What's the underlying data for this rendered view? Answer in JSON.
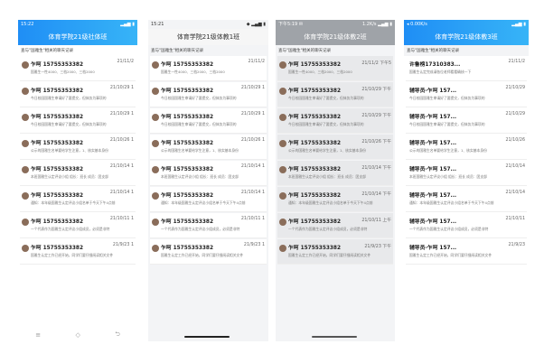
{
  "phones": [
    {
      "status": {
        "time": "15:22",
        "right": "▂▄▆ ▮"
      },
      "header": "体育学院21级社体班",
      "sub": "查与\"国雅生\"相关的聊天记录",
      "items": [
        {
          "name": "乍呵 15755353382",
          "date": "21/11/2",
          "msg": "国雅生一性4000、三档2000、三档2000"
        },
        {
          "name": "乍呵 15755353382",
          "date": "21/10/29 1",
          "msg": "今日校园国雅生审请好了要提交，但体务为事项的"
        },
        {
          "name": "乍呵 15755353382",
          "date": "21/10/29 1",
          "msg": "今日校园国雅生审请好了要提交，但体务为事项的"
        },
        {
          "name": "乍呵 15755353382",
          "date": "21/10/26 1",
          "msg": "公示的国雅生名单要给学生注意，1、核实基本身份"
        },
        {
          "name": "乍呵 15755353382",
          "date": "21/10/14 1",
          "msg": "本班国雅生认定评议小组 组长：班长 成员：团支部"
        },
        {
          "name": "乍呵 15755353382",
          "date": "21/10/14 1",
          "msg": "通知：本年级国雅生认定评议小组名单于今天下午4点前"
        },
        {
          "name": "乍呵 15755353382",
          "date": "21/10/11 1",
          "msg": "一个代表作为国雅生认定评议小组成员，必须是非特"
        },
        {
          "name": "乍呵 15755353382",
          "date": "21/9/23 1",
          "msg": "国雅生认定工作已经开始，同学们要仔细阅读相关文件"
        }
      ],
      "nav": [
        "≡",
        "◇",
        "⮌"
      ]
    },
    {
      "status": {
        "time": "15:21",
        "right": "◆ ▂▄▆ ▮"
      },
      "header": "体育学院21级体教1班",
      "sub": "查与\"国雅生\"相关的聊天记录",
      "items": [
        {
          "name": "乍呵 15755353382",
          "date": "21/11/2",
          "msg": "国雅生一性4000、三档2000、三档2000"
        },
        {
          "name": "乍呵 15755353382",
          "date": "21/10/29 1",
          "msg": "今日校园国雅生审请好了要提交，但体务为事项的"
        },
        {
          "name": "乍呵 15755353382",
          "date": "21/10/29 1",
          "msg": "今日校园国雅生审请好了要提交，但体务为事项的"
        },
        {
          "name": "乍呵 15755353382",
          "date": "21/10/26 1",
          "msg": "公示的国雅生名单要给学生注意，1、核实基本身份"
        },
        {
          "name": "乍呵 15755353382",
          "date": "21/10/14 1",
          "msg": "本班国雅生认定评议小组 组长：班长 成员：团支部"
        },
        {
          "name": "乍呵 15755353382",
          "date": "21/10/14 1",
          "msg": "通知：本年级国雅生认定评议小组名单于今天下午4点前"
        },
        {
          "name": "乍呵 15755353382",
          "date": "21/10/11 1",
          "msg": "一个代表作为国雅生认定评议小组成员，必须是非特"
        },
        {
          "name": "乍呵 15755353382",
          "date": "21/9/23 1",
          "msg": "国雅生认定工作已经开始，同学们要仔细阅读相关文件"
        }
      ]
    },
    {
      "status": {
        "time": "下午5:19 ✉",
        "right": "1.2K/s ▂▄▆ ▮"
      },
      "header": "体育学院21级体教2班",
      "sub": "查与\"国雅生\"相关的聊天记录",
      "items": [
        {
          "name": "乍呵 15755353382",
          "date": "21/11/2 下午5",
          "msg": "国雅生一性4000、三档2000、三档2000"
        },
        {
          "name": "乍呵 15755353382",
          "date": "21/10/29 下午",
          "msg": "今日校园国雅生审请好了要提交，但体务为事项的"
        },
        {
          "name": "乍呵 15755353382",
          "date": "21/10/29 下午",
          "msg": "今日校园国雅生审请好了要提交，但体务为事项的"
        },
        {
          "name": "乍呵 15755353382",
          "date": "21/10/26 下午",
          "msg": "公示的国雅生名单要给学生注意，1、核实基本身份"
        },
        {
          "name": "乍呵 15755353382",
          "date": "21/10/14 下午",
          "msg": "本班国雅生认定评议小组 组长：班长 成员：团支部"
        },
        {
          "name": "乍呵 15755353382",
          "date": "21/10/14 下午",
          "msg": "通知：本年级国雅生认定评议小组名单于今天下午4点前"
        },
        {
          "name": "乍呵 15755353382",
          "date": "21/10/11 上午",
          "msg": "一个代表作为国雅生认定评议小组成员，必须是非特"
        },
        {
          "name": "乍呵 15755353382",
          "date": "21/9/23 下午",
          "msg": "国雅生认定工作已经开始，同学们要仔细阅读相关文件"
        }
      ]
    },
    {
      "status": {
        "time": "◂ 0.00K/s",
        "right": "▂▄▆ ▮"
      },
      "header": "体育学院21级体教3班",
      "sub": "查与\"国雅生\"相关的聊天记录",
      "items": [
        {
          "name": "许鲁榜17310383...",
          "date": "21/11/2",
          "msg": "国雅生认定完成请各位老师看看确核一下"
        },
        {
          "name": "辅导员-乍呵 157...",
          "date": "21/10/29",
          "msg": "今日校园国雅生审请好了要提交，但体务为事项的"
        },
        {
          "name": "辅导员-乍呵 157...",
          "date": "21/10/29",
          "msg": "今日校园国雅生审请好了要提交，但体务为事项的"
        },
        {
          "name": "辅导员-乍呵 157...",
          "date": "21/10/26",
          "msg": "公示的国雅生名单要给学生注意，1、核实基本身份"
        },
        {
          "name": "辅导员-乍呵 157...",
          "date": "21/10/14",
          "msg": "本班国雅生认定评议小组 组长：班长 成员：团支部"
        },
        {
          "name": "辅导员-乍呵 157...",
          "date": "21/10/14",
          "msg": "通知：本年级国雅生认定评议小组名单于今天下午4点前"
        },
        {
          "name": "辅导员-乍呵 157...",
          "date": "21/10/11",
          "msg": "一个代表作为国雅生认定评议小组成员，必须是非特"
        },
        {
          "name": "辅导员-乍呵 157...",
          "date": "21/9/23",
          "msg": "国雅生认定工作已经开始，同学们要仔细阅读相关文件"
        }
      ]
    }
  ]
}
